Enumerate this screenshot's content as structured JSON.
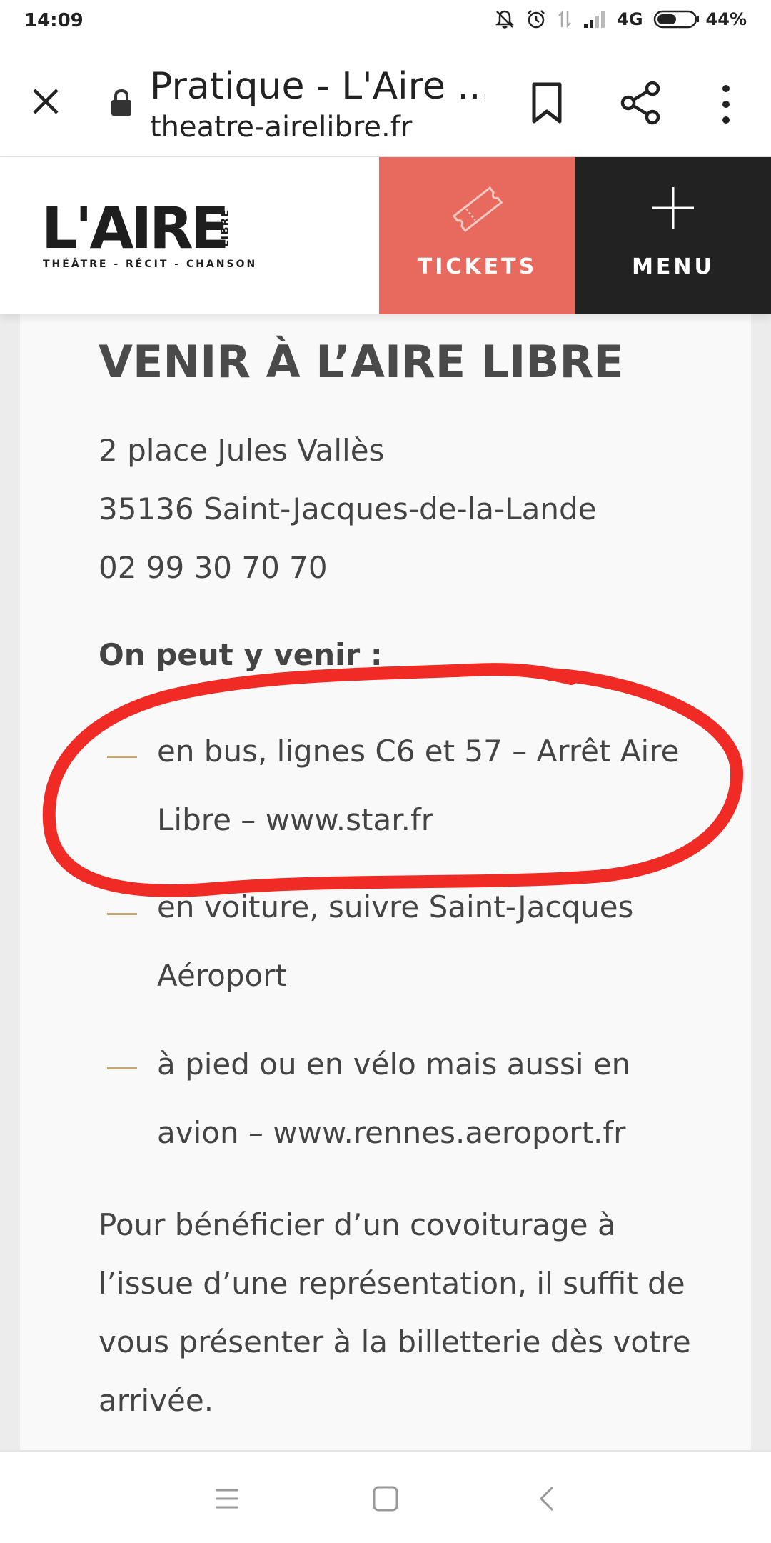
{
  "status": {
    "time": "14:09",
    "network": "4G",
    "battery": "44%"
  },
  "toolbar": {
    "title": "Pratique - L'Aire ...",
    "url": "theatre-airelibre.fr"
  },
  "site": {
    "logo_text": "L'AIRE",
    "logo_side": "LIBRE",
    "logo_tagline": "THÉÂTRE - RÉCIT - CHANSON",
    "tickets_label": "TICKETS",
    "menu_label": "MENU"
  },
  "content": {
    "heading": "VENIR À L’AIRE LIBRE",
    "address": [
      "2 place Jules Vallès",
      "35136 Saint-Jacques-de-la-Lande",
      "02 99 30 70 70"
    ],
    "lead": "On peut y venir :",
    "items": [
      [
        "en bus, lignes C6 et 57 – Arrêt Aire",
        "Libre – www.star.fr"
      ],
      [
        "en voiture, suivre Saint-Jacques",
        "Aéroport"
      ],
      [
        "à pied ou en vélo mais aussi en",
        "avion – www.rennes.aeroport.fr"
      ]
    ],
    "paragraph": [
      "Pour bénéficier d’un covoiturage à",
      "l’issue d’une représentation, il suffit de",
      "vous présenter à la billetterie dès votre",
      "arrivée."
    ]
  },
  "colors": {
    "accent": "#e86a5f",
    "dash": "#c5a572",
    "annotation": "#f02a24"
  }
}
